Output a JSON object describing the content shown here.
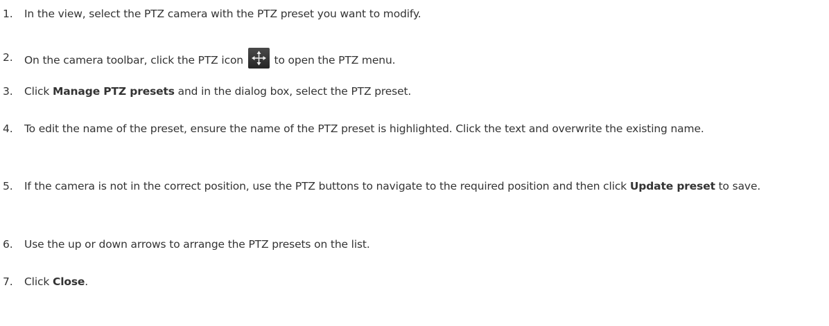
{
  "steps": [
    {
      "num": "1.",
      "text": "In the view, select the PTZ camera with the PTZ preset you want to modify."
    },
    {
      "num": "2.",
      "before": "On the camera toolbar, click the PTZ icon",
      "icon": "ptz-move-icon",
      "after": "to open the PTZ menu."
    },
    {
      "num": "3.",
      "before": "Click ",
      "bold": "Manage PTZ presets",
      "after": " and in the dialog box, select the PTZ preset."
    },
    {
      "num": "4.",
      "text": "To edit the name of the preset, ensure the name of the PTZ preset is highlighted. Click the text and overwrite the existing name."
    },
    {
      "num": "5.",
      "before": "If the camera is not in the correct position, use the PTZ buttons to navigate to the required position and then click ",
      "bold": "Update preset",
      "after": " to save."
    },
    {
      "num": "6.",
      "text": "Use the up or down arrows to arrange the PTZ presets on the list."
    },
    {
      "num": "7.",
      "before": "Click ",
      "bold": "Close",
      "after": "."
    }
  ]
}
